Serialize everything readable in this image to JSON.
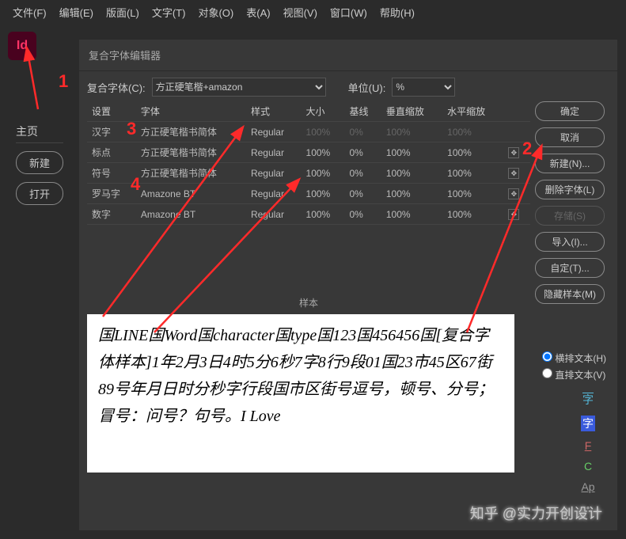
{
  "menu": {
    "items": [
      "文件(F)",
      "编辑(E)",
      "版面(L)",
      "文字(T)",
      "对象(O)",
      "表(A)",
      "视图(V)",
      "窗口(W)",
      "帮助(H)"
    ]
  },
  "app": {
    "letters": "Id"
  },
  "sidebar": {
    "title": "主页",
    "new_btn": "新建",
    "open_btn": "打开"
  },
  "dialog": {
    "title": "复合字体编辑器",
    "composite_label": "复合字体(C):",
    "composite_value": "方正硬笔楷+amazon",
    "unit_label": "单位(U):",
    "unit_value": "%",
    "headers": [
      "设置",
      "字体",
      "样式",
      "大小",
      "基线",
      "垂直缩放",
      "水平缩放",
      ""
    ],
    "rows": [
      {
        "set": "汉字",
        "font": "方正硬笔楷书简体",
        "style": "Regular",
        "size": "100%",
        "base": "0%",
        "vs": "100%",
        "hs": "100%",
        "dim": true,
        "move": false
      },
      {
        "set": "标点",
        "font": "方正硬笔楷书简体",
        "style": "Regular",
        "size": "100%",
        "base": "0%",
        "vs": "100%",
        "hs": "100%",
        "dim": false,
        "move": true
      },
      {
        "set": "符号",
        "font": "方正硬笔楷书简体",
        "style": "Regular",
        "size": "100%",
        "base": "0%",
        "vs": "100%",
        "hs": "100%",
        "dim": false,
        "move": true
      },
      {
        "set": "罗马字",
        "font": "Amazone BT",
        "style": "Regular",
        "size": "100%",
        "base": "0%",
        "vs": "100%",
        "hs": "100%",
        "dim": false,
        "move": true
      },
      {
        "set": "数字",
        "font": "Amazone BT",
        "style": "Regular",
        "size": "100%",
        "base": "0%",
        "vs": "100%",
        "hs": "100%",
        "dim": false,
        "move": true
      }
    ],
    "buttons": {
      "ok": "确定",
      "cancel": "取消",
      "new": "新建(N)...",
      "delete": "删除字体(L)",
      "save": "存储(S)",
      "import": "导入(I)...",
      "custom": "自定(T)...",
      "hide": "隐藏样本(M)"
    },
    "sample_label": "样本",
    "sample_text": "国LINE国Word国character国type国123国456456国[复合字体样本]1年2月3日4时5分6秒7字8行9段01国23市45区67街89号年月日时分秒字行段国市区街号逗号，顿号、分号；冒号：问号？句号。I Love",
    "radio": {
      "h": "横排文本(H)",
      "v": "直排文本(V)"
    },
    "icons": [
      "字",
      "字",
      "F",
      "C",
      "Ap",
      "•"
    ]
  },
  "annotations": {
    "n1": "1",
    "n2": "2",
    "n3": "3",
    "n4": "4"
  },
  "watermark": "知乎 @实力开创设计"
}
